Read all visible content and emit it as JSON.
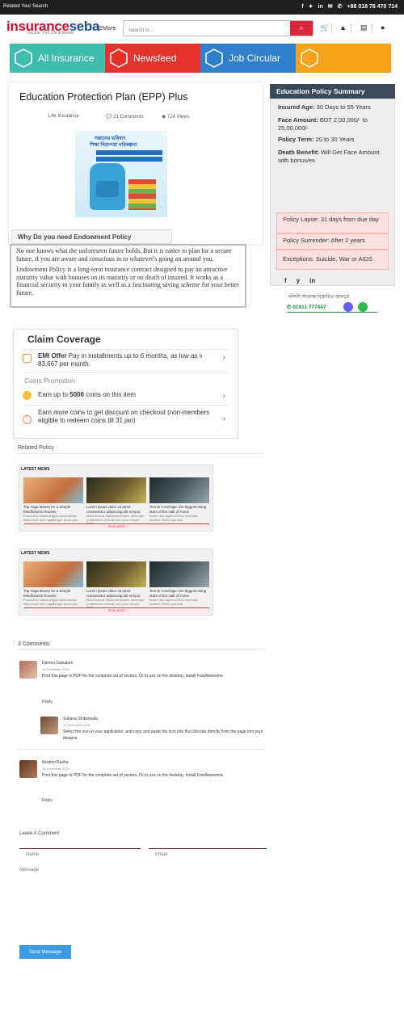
{
  "topbar": {
    "left_text": "Related Your Search",
    "phone": "+88 018 78 470 714",
    "icons": [
      "facebook-icon",
      "twitter-icon",
      "linkedin-icon",
      "mail-icon",
      "phone-icon"
    ]
  },
  "header": {
    "logo_main": "insurance",
    "logo_accent": "seba",
    "tagline": "Secure Your Life & Assets",
    "more_label": "More",
    "search_placeholder": "Search In...",
    "icons": [
      "search-icon",
      "cart-icon",
      "bell-icon",
      "note-icon",
      "user-icon"
    ]
  },
  "nav_tiles": [
    {
      "label": "All Insurance",
      "color": "#3fbcae"
    },
    {
      "label": "Newsfeed",
      "color": "#e5322d"
    },
    {
      "label": "Job Circular",
      "color": "#2f7fca"
    },
    {
      "label": "",
      "color": "#f7a21b"
    }
  ],
  "article": {
    "title": "Education Protection Plan (EPP) Plus",
    "category": "Life Insurance",
    "comments": "21 Comments",
    "views": "724 Views",
    "promo_line1": "সন্তানের ভবিষ্যৎ",
    "promo_line2": "শিক্ষা নিরাপত্তা পরিকল্পনা"
  },
  "why": {
    "heading": "Why Do you need Endowment Policy",
    "para1": "No one knows what the unforeseen future holds. But it is easier to plan for a secure future, if you are aware and conscious in to whatever's going on around you.",
    "para2": "Endowment Policy is a long-term insurance contract designed to pay an attractive maturity value with bonuses on its maturity or on death of insured. It works as a financial security to your family as well as a fascinating saving scheme for your better future."
  },
  "summary": {
    "heading": "Education Policy Summary",
    "insured_age_label": "Insured Age:",
    "insured_age": "30 Days to 55 Years",
    "face_amount_label": "Face Amount:",
    "face_amount": "BDT 2,00,000/- to 25,00,000/-",
    "policy_term_label": "Policy Term:",
    "policy_term": "20 to 30 Years",
    "death_benefit_label": "Death Benefit:",
    "death_benefit": "Will Get Face Amount with bonus/es",
    "policy_lapse": "Policy Lapse: 31 days from due day",
    "policy_surrender": "Policy Surrender: After 2 years",
    "exceptions": "Exceptions: Suicide, War or AIDS",
    "social": [
      "f",
      "y",
      "in"
    ],
    "bn_contact_text": "পলিসি সংক্রান্ত বিস্তারিত জানতে",
    "contact_phone": "01911 777447"
  },
  "claim": {
    "title": "Claim Coverage",
    "emi_strong": "EMI Offer",
    "emi_text": "Pay in installments up to 6 months, as low as ৳ 83,667 per month.",
    "coins_title": "Coins Promotion",
    "coins_text_pre": "Earn up to",
    "coins_amount": "5000",
    "coins_text_post": "coins on this item",
    "discount_text": "Earn more coins to get discount on checkout (non-members eligible to redeem coins till 31 jan)"
  },
  "related": {
    "heading": "Related Policy",
    "boxes": [
      {
        "label": "LATEST NEWS",
        "read_more": "READ MORE",
        "cards": [
          {
            "title": "Top Yoga Moves for a Simple Mindfulness Routine",
            "sub": "Praesent ac massa at ligula laoreet iaculis. Nulla neque dolor, sagittis eget, iaculis quis"
          },
          {
            "title": "Lorem ipsum dolor sit amet consectetur adipiscing elit tempor",
            "sub": "Etiam rhoncus. Maecenas tempus, tellus eget condimentum rhoncus, sem quam semper libero"
          },
          {
            "title": "Tennis Coverage: the biggest rising stars of the Hall of Fame",
            "sub": "Donec vitae sapien ut libero venenatis faucibus. Nullam quis ante"
          }
        ]
      },
      {
        "label": "LATEST NEWS",
        "read_more": "READ MORE",
        "cards": [
          {
            "title": "Top Yoga Moves for a Simple Mindfulness Routine",
            "sub": "Praesent ac massa at ligula laoreet iaculis. Nulla neque dolor, sagittis eget, iaculis quis"
          },
          {
            "title": "Lorem ipsum dolor sit amet consectetur adipiscing elit tempor",
            "sub": "Etiam rhoncus. Maecenas tempus, tellus eget condimentum rhoncus, sem quam semper libero"
          },
          {
            "title": "Tennis Coverage: the biggest rising stars of the Hall of Fame",
            "sub": "Donec vitae sapien ut libero venenatis faucibus. Nullam quis ante"
          }
        ]
      }
    ]
  },
  "comments": {
    "heading": "3 Comments",
    "items": [
      {
        "name": "Damon Salvatore",
        "date": "14 December 2021",
        "text": "Print this page to PDF for the complete set of vectors. Or to use on the desktop, install FontAwesome.",
        "reply": "Reply"
      },
      {
        "name": "Sultana Shikerwala",
        "date": "14 December 2021",
        "text": "Select the icon in your application, and copy and paste the icon into the Unicode directly from the page into your designs.",
        "reply": ""
      },
      {
        "name": "Ibrahim Rasha",
        "date": "14 December 2021",
        "text": "Print this page to PDF for the complete set of vectors. Or to use on the desktop, install FontAwesome.",
        "reply": "Reply"
      }
    ]
  },
  "form": {
    "heading": "Leave A Comment",
    "name_placeholder": "Name",
    "email_placeholder": "Email",
    "message_placeholder": "Message",
    "send_label": "Send Message"
  }
}
